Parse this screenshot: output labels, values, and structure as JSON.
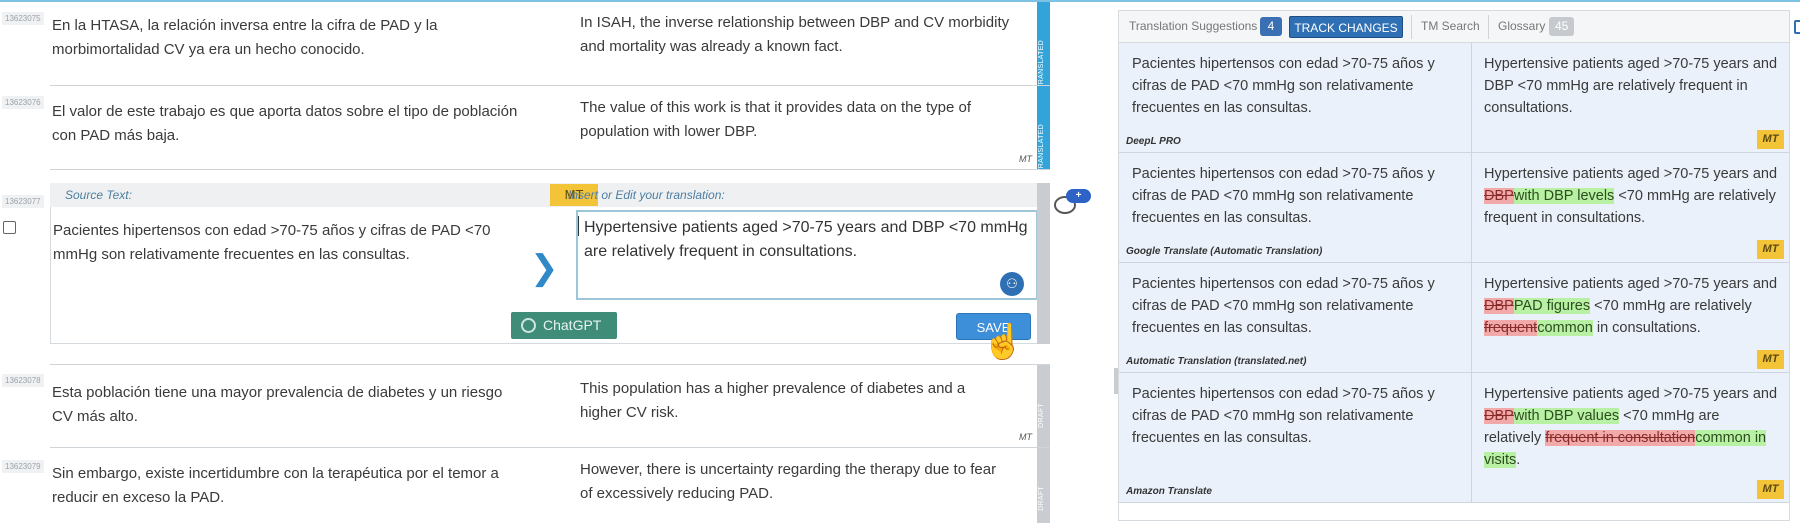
{
  "segments": [
    {
      "id": "13623075",
      "source": "En la HTASA, la relación inversa entre la cifra de PAD y la morbimortalidad CV ya era un hecho conocido.",
      "target": "In ISAH, the inverse relationship between DBP and CV morbidity and mortality was already a known fact.",
      "status": "TRANSLATED",
      "origin": ""
    },
    {
      "id": "13623076",
      "source": "El valor de este trabajo es que aporta datos sobre el tipo de población con PAD más baja.",
      "target": "The value of this work is that it provides data on the type of population with lower DBP.",
      "status": "TRANSLATED",
      "origin": "MT"
    },
    {
      "id": "13623078",
      "source": "Esta población tiene una mayor prevalencia de diabetes y un riesgo CV más alto.",
      "target": "This population has a higher prevalence of diabetes and a higher CV risk.",
      "status": "DRAFT",
      "origin": "MT"
    },
    {
      "id": "13623079",
      "source": "Sin embargo, existe incertidumbre con la terapéutica por el temor a reducir en exceso la PAD.",
      "target": "However, there is uncertainty regarding the therapy due to fear of excessively reducing PAD.",
      "status": "DRAFT",
      "origin": ""
    }
  ],
  "active": {
    "id": "13623077",
    "source_label": "Source Text:",
    "mt_badge": "MT",
    "edit_label": "Insert or Edit your translation:",
    "source": "Pacientes hipertensos con edad >70-75 años y cifras de PAD <70 mmHg son relativamente frecuentes en las consultas.",
    "translation": "Hypertensive patients aged >70-75 years and DBP <70 mmHg are relatively frequent in consultations.",
    "chatgpt_label": "ChatGPT",
    "save_label": "SAVE",
    "status": "DRAFT",
    "next_glyph": "❯",
    "comment_badge": "+"
  },
  "panel": {
    "tabs": {
      "suggestions_label": "Translation Suggestions",
      "suggestions_count": "4",
      "track_changes_label": "TRACK CHANGES",
      "tm_search_label": "TM Search",
      "glossary_label": "Glossary",
      "glossary_count": "45"
    },
    "suggestions": [
      {
        "engine": "DeepL PRO",
        "source": "Pacientes hipertensos con edad >70-75 años y cifras de PAD <70 mmHg son relativamente frecuentes en las consultas.",
        "target": "Hypertensive patients aged >70-75 years and DBP <70 mmHg are relatively frequent in consultations.",
        "badge": "MT"
      },
      {
        "engine": "Google Translate (Automatic Translation)",
        "source": "Pacientes hipertensos con edad >70-75 años y cifras de PAD <70 mmHg son relativamente frecuentes en las consultas.",
        "t1": "Hypertensive patients aged >70-75 years and ",
        "del1": "DBP",
        "ins1": "with DBP levels",
        "t2": " <70 mmHg are relatively frequent in consultations.",
        "badge": "MT"
      },
      {
        "engine": "Automatic Translation (translated.net)",
        "source": "Pacientes hipertensos con edad >70-75 años y cifras de PAD <70 mmHg son relativamente frecuentes en las consultas.",
        "t1": "Hypertensive patients aged >70-75 years and ",
        "del1": "DBP",
        "ins1": "PAD figures",
        "t2": " <70 mmHg are relatively ",
        "del2": "frequent",
        "ins2": "common",
        "t3": " in consultations.",
        "badge": "MT"
      },
      {
        "engine": "Amazon Translate",
        "source": "Pacientes hipertensos con edad >70-75 años y cifras de PAD <70 mmHg son relativamente frecuentes en las consultas.",
        "t1": "Hypertensive patients aged >70-75 years and ",
        "del1": "DBP",
        "ins1": "with DBP values",
        "t2": " <70 mmHg are relatively ",
        "del2": "frequent in consultation",
        "ins2": "common in visits",
        "t3": ".",
        "badge": "MT"
      }
    ]
  },
  "colors": {
    "translated_bar": "#32a4d9",
    "draft_bar": "#c9cdd1",
    "mt_badge": "#f3c338",
    "save_button": "#3d8fd9",
    "chatgpt_button": "#3f8d78",
    "deleted": "#f2a9a9",
    "inserted": "#b8f0a4"
  }
}
